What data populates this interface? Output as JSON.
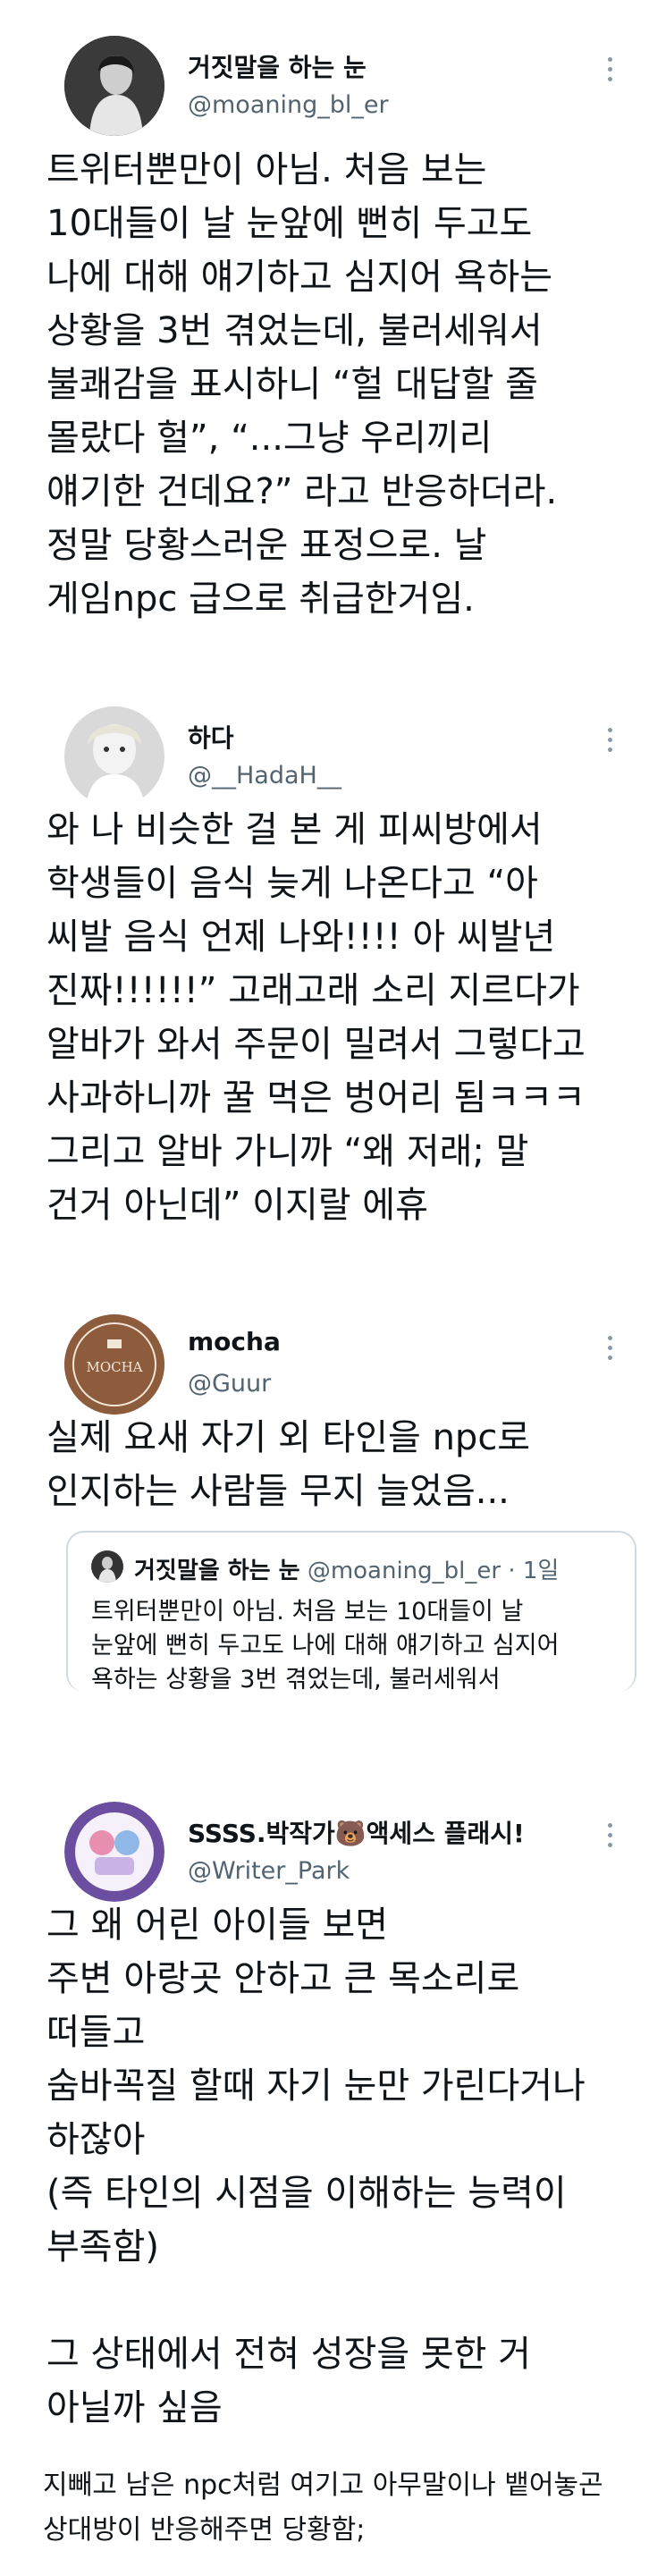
{
  "tweets": [
    {
      "name": "거짓말을 하는 눈",
      "handle": "@moaning_bl_er",
      "lines": [
        "트위터뿐만이 아님. 처음 보는",
        "10대들이 날 눈앞에 뻔히 두고도",
        "나에 대해 얘기하고 심지어 욕하는",
        "상황을 3번 겪었는데, 불러세워서",
        "불쾌감을 표시하니 “헐 대답할 줄",
        "몰랐다 헐”, “...그냥 우리끼리",
        "얘기한 건데요?” 라고 반응하더라.",
        "정말 당황스러운 표정으로. 날",
        "게임npc 급으로 취급한거임."
      ]
    },
    {
      "name": "하다",
      "handle": "@__HadaH__",
      "lines": [
        "와 나 비슷한 걸 본 게 피씨방에서",
        "학생들이 음식 늦게 나온다고 “아",
        "씨발 음식 언제 나와!!!! 아 씨발년",
        "진짜!!!!!!” 고래고래 소리 지르다가",
        "알바가 와서 주문이 밀려서 그렇다고",
        "사과하니까 꿀 먹은 벙어리 됨ㅋㅋㅋ",
        "그리고 알바 가니까 “왜 저래; 말",
        "건거 아닌데” 이지랄 에휴"
      ]
    },
    {
      "name": "mocha",
      "handle": "@Guur",
      "avatar_text": "MOCHA",
      "lines": [
        "실제 요새 자기 외 타인을 npc로",
        "인지하는 사람들 무지 늘었음..."
      ],
      "quote": {
        "name": "거짓말을 하는 눈",
        "meta": "@moaning_bl_er · 1일",
        "lines": [
          "트위터뿐만이 아님. 처음 보는 10대들이 날",
          "눈앞에 뻔히 두고도 나에 대해 얘기하고 심지어",
          "욕하는 상황을 3번 겪었는데, 불러세워서"
        ]
      }
    },
    {
      "name": "SSSS.박작가🐻액세스 플래시!",
      "handle": "@Writer_Park",
      "lines": [
        "그 왜 어린 아이들 보면",
        "주변 아랑곳 안하고 큰 목소리로",
        "떠들고",
        "숨바꼭질 할때 자기 눈만 가린다거나",
        "하잖아",
        "(즉 타인의 시점을 이해하는 능력이",
        "부족함)",
        "",
        "그 상태에서 전혀 성장을 못한 거",
        "아닐까 싶음"
      ]
    }
  ],
  "caption": [
    "지빼고 남은 npc처럼 여기고 아무말이나 뱉어놓곤",
    "상대방이 반응해주면 당황함;"
  ],
  "colors": {
    "text": "#0f1419",
    "secondary": "#536471",
    "border": "#cfd9de"
  }
}
